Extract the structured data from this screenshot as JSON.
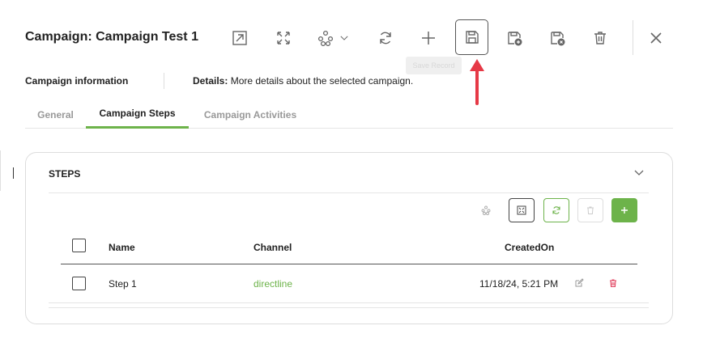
{
  "header": {
    "title": "Campaign: Campaign Test 1",
    "toolbar": [
      {
        "name": "open-external-button",
        "icon": "open-external-icon"
      },
      {
        "name": "expand-button",
        "icon": "expand-icon"
      },
      {
        "name": "workflow-menu-button",
        "icon": "workflow-icon"
      },
      {
        "name": "refresh-button",
        "icon": "refresh-icon"
      },
      {
        "name": "add-button",
        "icon": "plus-icon"
      },
      {
        "name": "save-button",
        "icon": "save-icon",
        "active": true
      },
      {
        "name": "save-and-new-button",
        "icon": "save-plus-icon"
      },
      {
        "name": "save-and-close-button",
        "icon": "save-close-icon"
      },
      {
        "name": "delete-button",
        "icon": "trash-icon"
      },
      {
        "name": "close-button",
        "icon": "close-icon"
      }
    ],
    "tooltip": "Save Record"
  },
  "info": {
    "label": "Campaign information",
    "details_label": "Details:",
    "details_text": "More details about the selected campaign."
  },
  "tabs": [
    {
      "label": "General",
      "active": false
    },
    {
      "label": "Campaign Steps",
      "active": true
    },
    {
      "label": "Campaign Activities",
      "active": false
    }
  ],
  "steps": {
    "title": "STEPS",
    "columns": [
      "Name",
      "Channel",
      "CreatedOn"
    ],
    "rows": [
      {
        "name": "Step 1",
        "channel": "directline",
        "created_on": "11/18/24, 5:21 PM"
      }
    ]
  },
  "colors": {
    "accent": "#6db34a",
    "danger": "#e0405e",
    "arrow": "#e63946"
  }
}
